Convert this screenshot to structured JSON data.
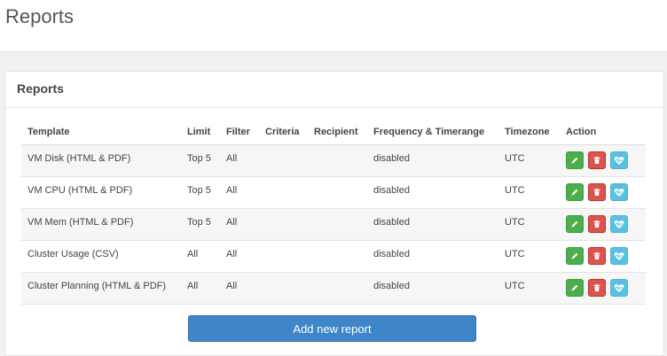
{
  "page": {
    "title": "Reports"
  },
  "panel": {
    "title": "Reports"
  },
  "table": {
    "headers": {
      "template": "Template",
      "limit": "Limit",
      "filter": "Filter",
      "criteria": "Criteria",
      "recipient": "Recipient",
      "frequency": "Frequency & Timerange",
      "timezone": "Timezone",
      "action": "Action"
    },
    "rows": [
      {
        "template": "VM Disk (HTML & PDF)",
        "limit": "Top 5",
        "filter": "All",
        "criteria": "",
        "recipient": "",
        "frequency": "disabled",
        "timezone": "UTC"
      },
      {
        "template": "VM CPU (HTML & PDF)",
        "limit": "Top 5",
        "filter": "All",
        "criteria": "",
        "recipient": "",
        "frequency": "disabled",
        "timezone": "UTC"
      },
      {
        "template": "VM Mem (HTML & PDF)",
        "limit": "Top 5",
        "filter": "All",
        "criteria": "",
        "recipient": "",
        "frequency": "disabled",
        "timezone": "UTC"
      },
      {
        "template": "Cluster Usage (CSV)",
        "limit": "All",
        "filter": "All",
        "criteria": "",
        "recipient": "",
        "frequency": "disabled",
        "timezone": "UTC"
      },
      {
        "template": "Cluster Planning (HTML & PDF)",
        "limit": "All",
        "filter": "All",
        "criteria": "",
        "recipient": "",
        "frequency": "disabled",
        "timezone": "UTC"
      }
    ],
    "action_icons": [
      "pencil-icon",
      "trash-icon",
      "heartbeat-icon"
    ]
  },
  "add_button": {
    "label": "Add new report"
  },
  "colors": {
    "edit": "#4cae4c",
    "delete": "#d9534f",
    "send": "#5bc0de",
    "primary": "#3e86c8"
  }
}
